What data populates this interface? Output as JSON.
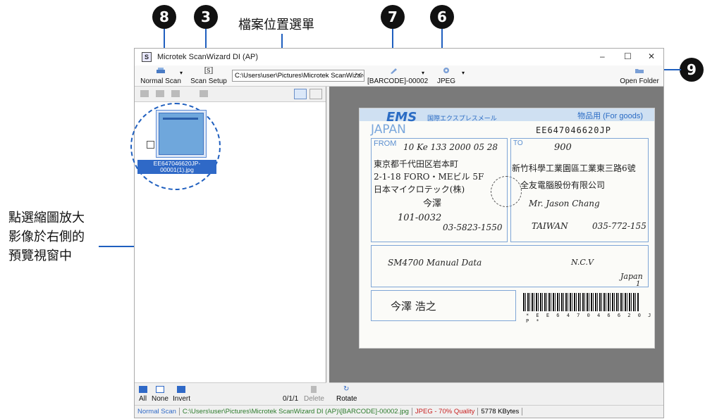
{
  "callouts": {
    "badge_8": "8",
    "badge_3": "3",
    "badge_7": "7",
    "badge_6": "6",
    "badge_9": "9",
    "file_location_menu": "檔案位置選單",
    "thumb_note_line1": "點選縮圖放大",
    "thumb_note_line2": "影像於右側的",
    "thumb_note_line3": "預覽視窗中"
  },
  "window": {
    "title": "Microtek ScanWizard DI (AP)",
    "app_icon": "S",
    "minimize": "–",
    "maximize": "☐",
    "close": "✕"
  },
  "toolbar": {
    "normal_scan": "Normal Scan",
    "scan_setup": "Scan Setup",
    "path": "C:\\Users\\user\\Pictures\\Microtek ScanWizarc",
    "filename": "[BARCODE]-00002",
    "format": "JPEG",
    "open_folder": "Open Folder"
  },
  "left_pane": {
    "thumb_label": "EE647046620JP-00001(1).jpg",
    "all": "All",
    "none": "None",
    "invert": "Invert",
    "count": "0/1/1",
    "delete": "Delete"
  },
  "right_pane": {
    "rotate": "Rotate"
  },
  "status": {
    "mode": "Normal Scan",
    "path": "C:\\Users\\user\\Pictures\\Microtek ScanWizard DI (AP)\\[BARCODE]-00002.jpg",
    "quality": "JPEG - 70% Quality",
    "size": "5778 KBytes"
  },
  "document": {
    "ems": "EMS",
    "ems_sub": "国際エクスプレスメール",
    "goods": "物品用 (For goods)",
    "japan": "JAPAN",
    "tracking": "EE647046620JP",
    "from": "FROM",
    "to": "TO",
    "date": "10 Ke 133 2000 05 28",
    "sender1": "東京都千代田区岩本町",
    "sender2": "2-1-18 FORO・MEビル 5F",
    "sender3": "日本マイクロテック(株)",
    "sender4": "今澤",
    "postal": "101-0032",
    "tel": "03-5823-1550",
    "recv1": "新竹科學工業園區工業東三路6號",
    "recv2": "全友電腦股份有限公司",
    "recv3": "Mr. Jason Chang",
    "country": "TAIWAN",
    "recv_tel": "035-772-155",
    "contents": "SM4700 Manual Data",
    "ncv": "N.C.V",
    "origin": "Japan",
    "pieces": "1",
    "weight": "900",
    "signature": "今澤 浩之",
    "barcode_text": "* E E 6 4 7 0 4 6 6 2 0 J P *"
  }
}
